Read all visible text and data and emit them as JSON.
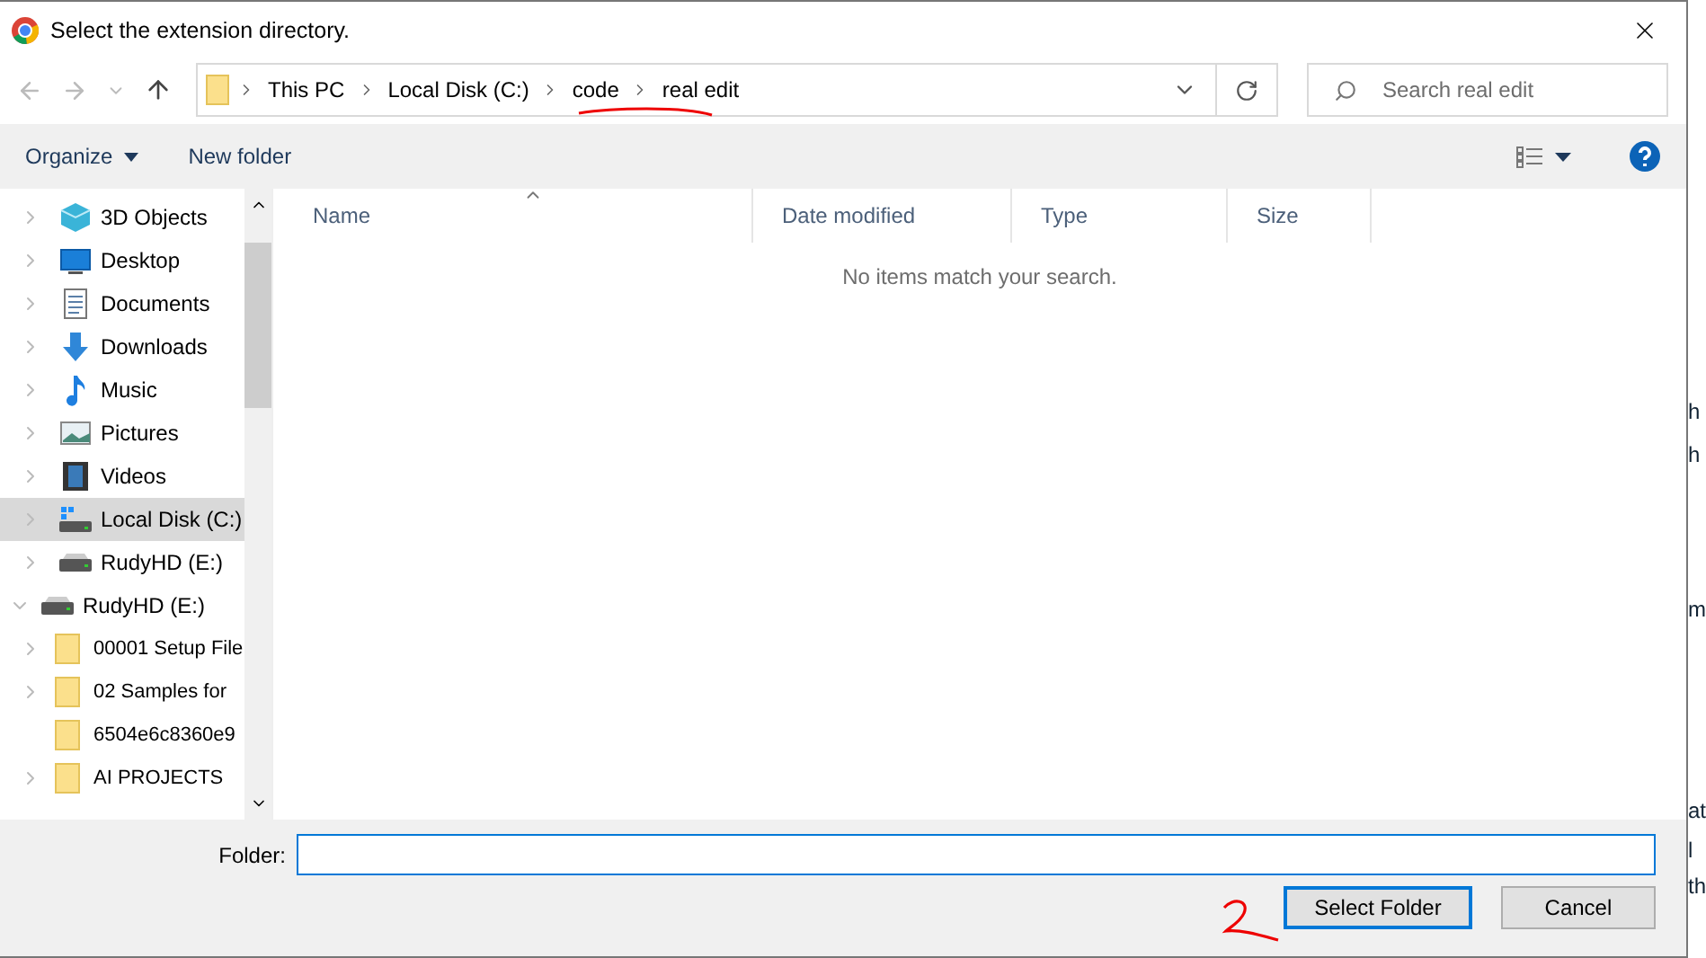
{
  "window": {
    "title": "Select the extension directory."
  },
  "address_bar": {
    "segments": [
      "This PC",
      "Local Disk (C:)",
      "code",
      "real edit"
    ]
  },
  "search": {
    "placeholder": "Search real edit"
  },
  "toolbar": {
    "organize": "Organize",
    "new_folder": "New folder"
  },
  "nav_tree": [
    {
      "label": "3D Objects",
      "kind": "cube",
      "expandable": true,
      "expanded": false,
      "selected": false
    },
    {
      "label": "Desktop",
      "kind": "desktop",
      "expandable": true,
      "expanded": false,
      "selected": false
    },
    {
      "label": "Documents",
      "kind": "documents",
      "expandable": true,
      "expanded": false,
      "selected": false
    },
    {
      "label": "Downloads",
      "kind": "downloads",
      "expandable": true,
      "expanded": false,
      "selected": false
    },
    {
      "label": "Music",
      "kind": "music",
      "expandable": true,
      "expanded": false,
      "selected": false
    },
    {
      "label": "Pictures",
      "kind": "pictures",
      "expandable": true,
      "expanded": false,
      "selected": false
    },
    {
      "label": "Videos",
      "kind": "videos",
      "expandable": true,
      "expanded": false,
      "selected": false
    },
    {
      "label": "Local Disk (C:)",
      "kind": "system-drive",
      "expandable": true,
      "expanded": false,
      "selected": true
    },
    {
      "label": "RudyHD (E:)",
      "kind": "drive",
      "expandable": true,
      "expanded": false,
      "selected": false
    },
    {
      "label": "RudyHD (E:)",
      "kind": "drive",
      "expandable": true,
      "expanded": true,
      "selected": false,
      "children": [
        {
          "label": "00001 Setup File",
          "kind": "folder",
          "expandable": true,
          "expanded": false,
          "selected": false
        },
        {
          "label": "02 Samples for",
          "kind": "folder",
          "expandable": true,
          "expanded": false,
          "selected": false
        },
        {
          "label": "6504e6c8360e9",
          "kind": "folder",
          "expandable": false,
          "expanded": false,
          "selected": false
        },
        {
          "label": "AI PROJECTS",
          "kind": "folder",
          "expandable": true,
          "expanded": false,
          "selected": false
        }
      ]
    }
  ],
  "table": {
    "columns": [
      "Name",
      "Date modified",
      "Type",
      "Size"
    ],
    "empty_message": "No items match your search."
  },
  "footer": {
    "folder_label": "Folder:",
    "buttons": [
      {
        "label": "Select Folder",
        "focused": true
      },
      {
        "label": "Cancel",
        "focused": false
      }
    ]
  },
  "background_page": [
    "h",
    "h",
    "m",
    "at",
    "l",
    "th"
  ]
}
